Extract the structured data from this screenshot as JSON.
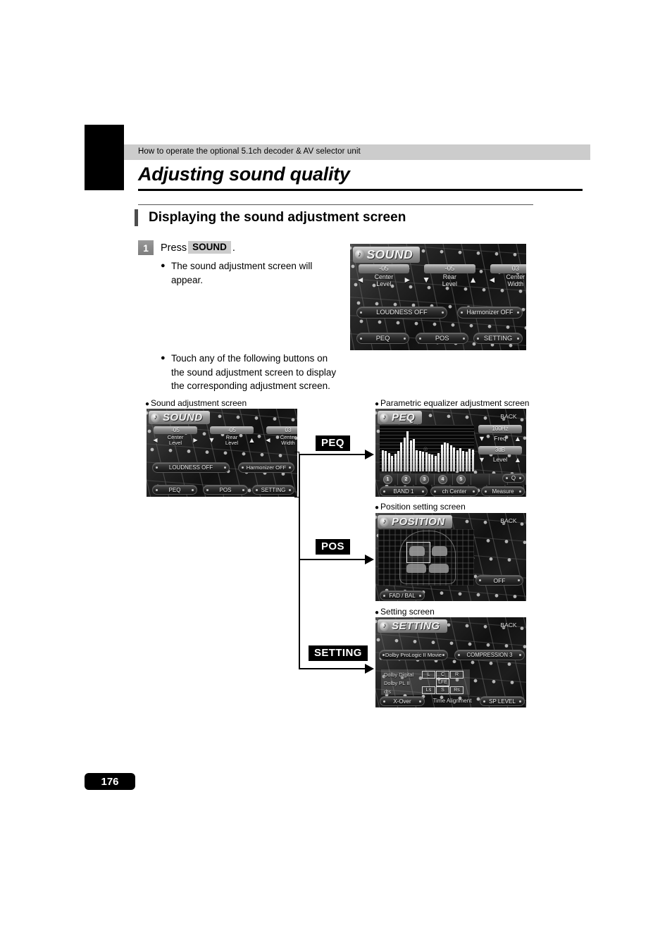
{
  "header": {
    "running_head": "How to operate the optional 5.1ch decoder & AV selector unit",
    "chapter_title": "Adjusting sound quality",
    "section_title": "Displaying the sound adjustment screen"
  },
  "step": {
    "number": "1",
    "press_word": "Press",
    "key_label": "SOUND",
    "period": ".",
    "bullet1": "The sound adjustment screen will appear.",
    "bullet2": "Touch any of the following buttons on the sound adjustment screen to display the corresponding adjustment screen."
  },
  "captions": {
    "sound": "Sound adjustment screen",
    "peq": "Parametric equalizer adjustment screen",
    "position": "Position setting screen",
    "setting": "Setting  screen"
  },
  "flow_labels": {
    "peq": "PEQ",
    "pos": "POS",
    "setting": "SETTING"
  },
  "sound_screen": {
    "title": "SOUND",
    "note_icon": "music-note-icon",
    "params": [
      {
        "value": "-05",
        "label_line1": "Center",
        "label_line2": "Level",
        "left_icon": "chevron-left-icon",
        "right_icon": "chevron-right-icon"
      },
      {
        "value": "-05",
        "label_line1": "Rear",
        "label_line2": "Level",
        "left_icon": "chevron-down-icon",
        "right_icon": "chevron-up-icon"
      },
      {
        "value": "03",
        "label_line1": "Center",
        "label_line2": "Width",
        "left_icon": "chevron-left-icon",
        "right_icon": "chevron-right-icon"
      }
    ],
    "toggles": [
      "LOUDNESS  OFF",
      "Harmonizer  OFF"
    ],
    "bottom_buttons": [
      "PEQ",
      "POS",
      "SETTING"
    ]
  },
  "peq_screen": {
    "title": "PEQ",
    "back": "BACK",
    "freq_value": "100Hz",
    "freq_label": "Freq",
    "level_value": "3dB",
    "level_label": "Level",
    "q_label": "Q",
    "band_numbers": [
      "1",
      "2",
      "3",
      "4",
      "5"
    ],
    "bottom_buttons": [
      "BAND  1",
      "ch  Center",
      "Measure"
    ],
    "eq_bar_heights": [
      46,
      44,
      40,
      34,
      38,
      44,
      62,
      72,
      86,
      66,
      70,
      46,
      44,
      42,
      41,
      38,
      36,
      34,
      40,
      58,
      62,
      60,
      56,
      52,
      46,
      50,
      44,
      42,
      48,
      47
    ]
  },
  "position_screen": {
    "title": "POSITION",
    "back": "BACK",
    "off_button": "OFF",
    "fad_bal_button": "FAD / BAL"
  },
  "setting_screen": {
    "title": "SETTING",
    "back": "BACK",
    "mode_button": "Dolby ProLogic II  Movie",
    "compression_button": "COMPRESSION  3",
    "matrix_rows": [
      "Dolby Digital",
      "Dolby PL II",
      "dts"
    ],
    "matrix_cells_top": [
      "L",
      "C",
      "R"
    ],
    "matrix_cells_mid": [
      "LFE"
    ],
    "matrix_cells_bottom": [
      "Ls",
      "S",
      "Rs"
    ],
    "bottom_buttons": [
      "X-Over",
      "Time Alignment",
      "SP LEVEL"
    ]
  },
  "footer": {
    "page_number": "176"
  },
  "colors": {
    "header_band": "#cccccc",
    "chip_bg": "#cccccc",
    "flow_chip_bg": "#000000",
    "ink": "#000000"
  }
}
